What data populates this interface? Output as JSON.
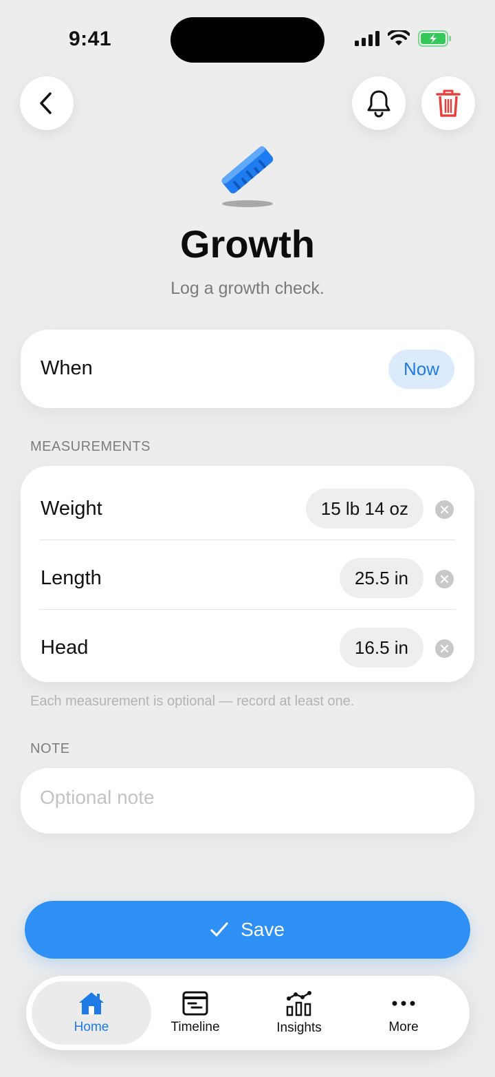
{
  "status": {
    "time": "9:41"
  },
  "header": {
    "title": "Growth",
    "subtitle": "Log a growth check."
  },
  "when": {
    "label": "When",
    "value": "Now"
  },
  "measurements": {
    "section_label": "MEASUREMENTS",
    "rows": [
      {
        "label": "Weight",
        "value": "15 lb 14 oz"
      },
      {
        "label": "Length",
        "value": "25.5 in"
      },
      {
        "label": "Head",
        "value": "16.5 in"
      }
    ],
    "hint": "Each measurement is optional — record at least one."
  },
  "note": {
    "section_label": "NOTE",
    "placeholder": "Optional note",
    "value": ""
  },
  "save_label": "Save",
  "tabs": [
    {
      "label": "Home",
      "icon": "home-icon",
      "active": true
    },
    {
      "label": "Timeline",
      "icon": "timeline-icon",
      "active": false
    },
    {
      "label": "Insights",
      "icon": "insights-icon",
      "active": false
    },
    {
      "label": "More",
      "icon": "more-icon",
      "active": false
    }
  ],
  "colors": {
    "accent": "#2E8FF5",
    "tab_active": "#1E7BE6",
    "delete": "#E5403A",
    "battery": "#34C759"
  }
}
